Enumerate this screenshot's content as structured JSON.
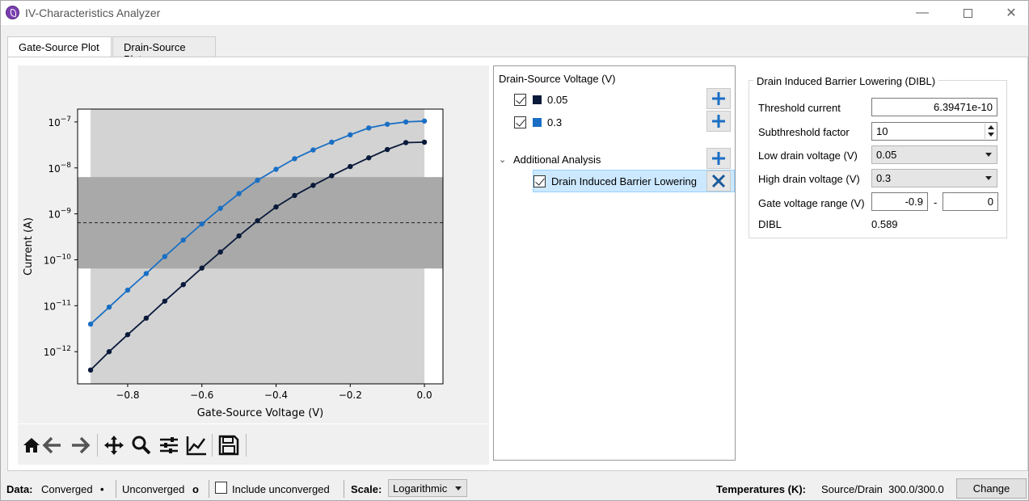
{
  "window": {
    "title": "IV-Characteristics Analyzer"
  },
  "tabs": [
    {
      "label": "Gate-Source Plot",
      "active": true
    },
    {
      "label": "Drain-Source Plot",
      "active": false
    }
  ],
  "chart_data": {
    "type": "line",
    "xlabel": "Gate-Source Voltage (V)",
    "ylabel": "Current (A)",
    "xlim": [
      -0.935,
      0.05
    ],
    "ylim_log10": [
      -12.7,
      -6.72
    ],
    "yscale": "log",
    "x_ticks": [
      "−0.8",
      "−0.6",
      "−0.4",
      "−0.2",
      "0.0"
    ],
    "x_tick_values": [
      -0.8,
      -0.6,
      -0.4,
      -0.2,
      0.0
    ],
    "y_tick_exponents": [
      -7,
      -8,
      -9,
      -10,
      -11,
      -12
    ],
    "x": [
      -0.9,
      -0.85,
      -0.8,
      -0.75,
      -0.7,
      -0.65,
      -0.6,
      -0.55,
      -0.5,
      -0.45,
      -0.4,
      -0.35,
      -0.3,
      -0.25,
      -0.2,
      -0.15,
      -0.1,
      -0.05,
      0.0
    ],
    "series": [
      {
        "name": "0.05",
        "color": "#0a1a3a",
        "log10_values": [
          -12.4,
          -12.0,
          -11.63,
          -11.27,
          -10.9,
          -10.54,
          -10.18,
          -9.83,
          -9.48,
          -9.15,
          -8.85,
          -8.6,
          -8.38,
          -8.17,
          -7.97,
          -7.78,
          -7.6,
          -7.45,
          -7.44
        ]
      },
      {
        "name": "0.3",
        "color": "#1a6fc4",
        "log10_values": [
          -11.4,
          -11.03,
          -10.66,
          -10.3,
          -9.93,
          -9.57,
          -9.22,
          -8.88,
          -8.56,
          -8.27,
          -8.03,
          -7.8,
          -7.61,
          -7.44,
          -7.28,
          -7.13,
          -7.05,
          -7.0,
          -6.98
        ]
      }
    ],
    "threshold_log10": -9.194,
    "band_log10": [
      -10.19,
      -8.2
    ],
    "grid": false
  },
  "toolbar": {
    "icons": [
      "home-icon",
      "back-arrow-icon",
      "forward-arrow-icon",
      "pan-icon",
      "zoom-icon",
      "configure-subplots-icon",
      "edit-axis-icon",
      "save-icon"
    ]
  },
  "tree": {
    "header": "Drain-Source Voltage (V)",
    "voltages": [
      {
        "label": "0.05",
        "color": "#0a1a3a",
        "checked": true
      },
      {
        "label": "0.3",
        "color": "#1a6fc4",
        "checked": true
      }
    ],
    "analysis_header": "Additional Analysis",
    "analysis_items": [
      {
        "label": "Drain Induced Barrier Lowering",
        "checked": true
      }
    ]
  },
  "dibl": {
    "group_title": "Drain Induced Barrier Lowering (DIBL)",
    "threshold_label": "Threshold current",
    "threshold_value": "6.39471e-10",
    "subthreshold_label": "Subthreshold factor",
    "subthreshold_value": "10",
    "low_label": "Low drain voltage (V)",
    "low_value": "0.05",
    "high_label": "High drain voltage (V)",
    "high_value": "0.3",
    "range_label": "Gate voltage range (V)",
    "range_min": "-0.9",
    "range_sep": "-",
    "range_max": "0",
    "dibl_label": "DIBL",
    "dibl_value": "0.589"
  },
  "status": {
    "data_label": "Data:",
    "converged": "Converged",
    "converged_marker": "•",
    "unconverged": "Unconverged",
    "unconverged_marker": "o",
    "include_unconverged": "Include unconverged",
    "scale_label": "Scale:",
    "scale_value": "Logarithmic",
    "temps_label": "Temperatures (K):",
    "temps_value": "Source/Drain  300.0/300.0",
    "change_button": "Change"
  }
}
